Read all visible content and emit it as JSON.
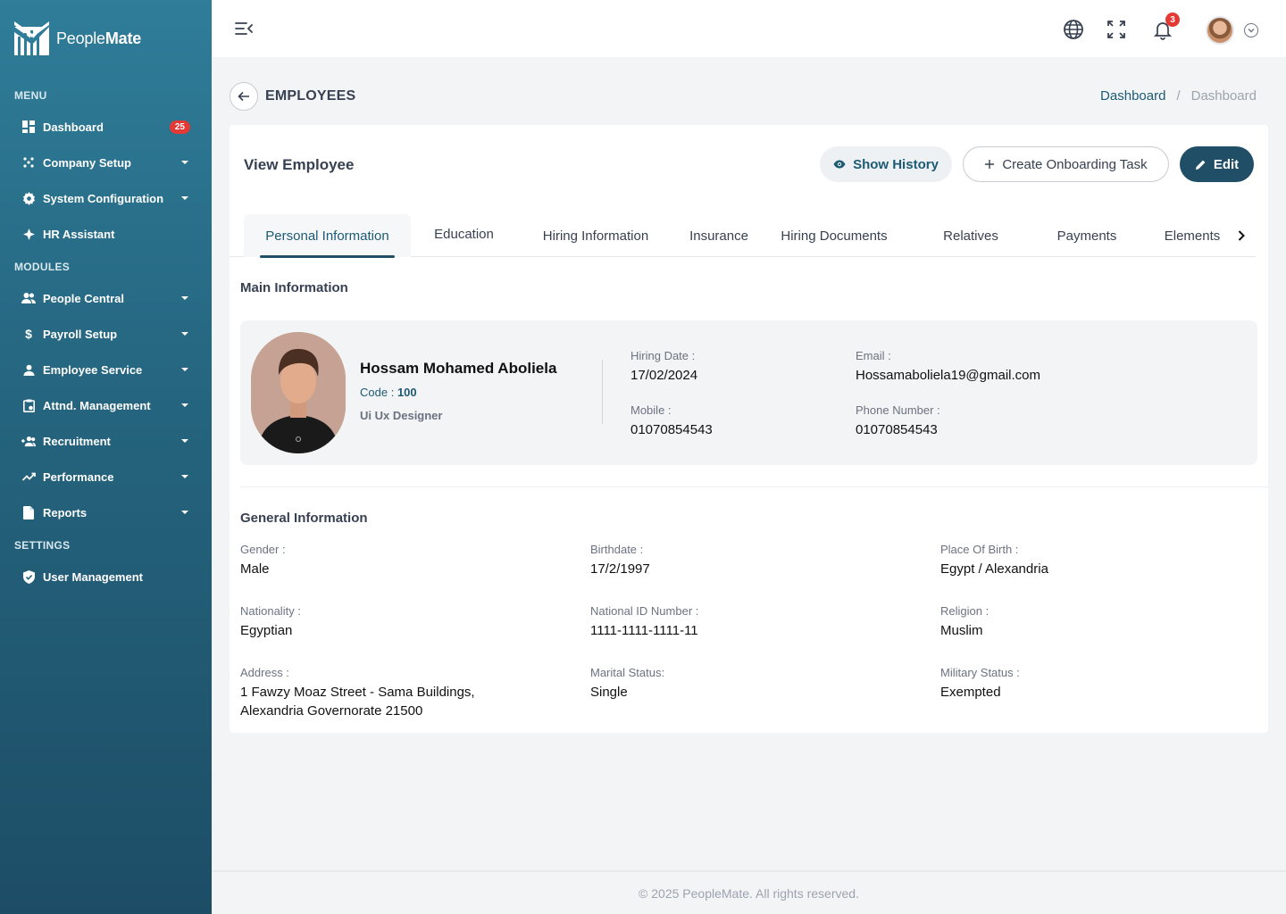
{
  "brand": {
    "name_light": "People",
    "name_bold": "Mate"
  },
  "sidebar": {
    "sections": [
      "MENU",
      "MODULES",
      "SETTINGS"
    ],
    "items": [
      {
        "label": "Dashboard",
        "icon": "dashboard-icon",
        "badge": "25"
      },
      {
        "label": "Company Setup",
        "icon": "company-icon"
      },
      {
        "label": "System Configuration",
        "icon": "gear-icon"
      },
      {
        "label": "HR Assistant",
        "icon": "sparkle-icon"
      },
      {
        "label": "People Central",
        "icon": "people-icon"
      },
      {
        "label": "Payroll Setup",
        "icon": "dollar-icon"
      },
      {
        "label": "Employee Service",
        "icon": "person-icon"
      },
      {
        "label": "Attnd. Management",
        "icon": "clipboard-icon"
      },
      {
        "label": "Recruitment",
        "icon": "add-people-icon"
      },
      {
        "label": "Performance",
        "icon": "trend-icon"
      },
      {
        "label": "Reports",
        "icon": "document-icon"
      },
      {
        "label": "User Management",
        "icon": "shield-icon"
      }
    ]
  },
  "topbar": {
    "notification_count": "3"
  },
  "page": {
    "title": "EMPLOYEES",
    "breadcrumb": [
      "Dashboard",
      "/",
      "Dashboard"
    ]
  },
  "card": {
    "title": "View Employee",
    "buttons": {
      "history": "Show History",
      "onboarding": "Create Onboarding Task",
      "edit": "Edit"
    },
    "tabs": [
      "Personal Information",
      "Education",
      "Hiring Information",
      "Insurance",
      "Hiring Documents",
      "Relatives",
      "Payments",
      "Elements"
    ],
    "active_tab": "Personal Information"
  },
  "main_info": {
    "section_title": "Main Information",
    "name": "Hossam Mohamed Aboliela",
    "code_label": "Code :",
    "code": "100",
    "role": "Ui Ux Designer",
    "hiring_date_label": "Hiring Date :",
    "hiring_date": "17/02/2024",
    "email_label": "Email :",
    "email": "Hossamaboliela19@gmail.com",
    "mobile_label": "Mobile :",
    "mobile": "01070854543",
    "phone_label": "Phone Number :",
    "phone": "01070854543"
  },
  "general_info": {
    "section_title": "General Information",
    "fields": [
      {
        "label": "Gender :",
        "value": "Male"
      },
      {
        "label": "Birthdate :",
        "value": "17/2/1997"
      },
      {
        "label": "Place Of Birth :",
        "value": "Egypt / Alexandria"
      },
      {
        "label": "Nationality :",
        "value": "Egyptian"
      },
      {
        "label": "National ID Number :",
        "value": "1111-1111-1111-11"
      },
      {
        "label": "Religion :",
        "value": "Muslim"
      },
      {
        "label": "Address :",
        "value": "1 Fawzy Moaz Street - Sama Buildings,",
        "value2": "Alexandria Governorate 21500"
      },
      {
        "label": "Marital Status:",
        "value": "Single"
      },
      {
        "label": "Military Status :",
        "value": "Exempted"
      }
    ]
  },
  "footer": {
    "text": "© 2025  PeopleMate. All rights reserved."
  }
}
